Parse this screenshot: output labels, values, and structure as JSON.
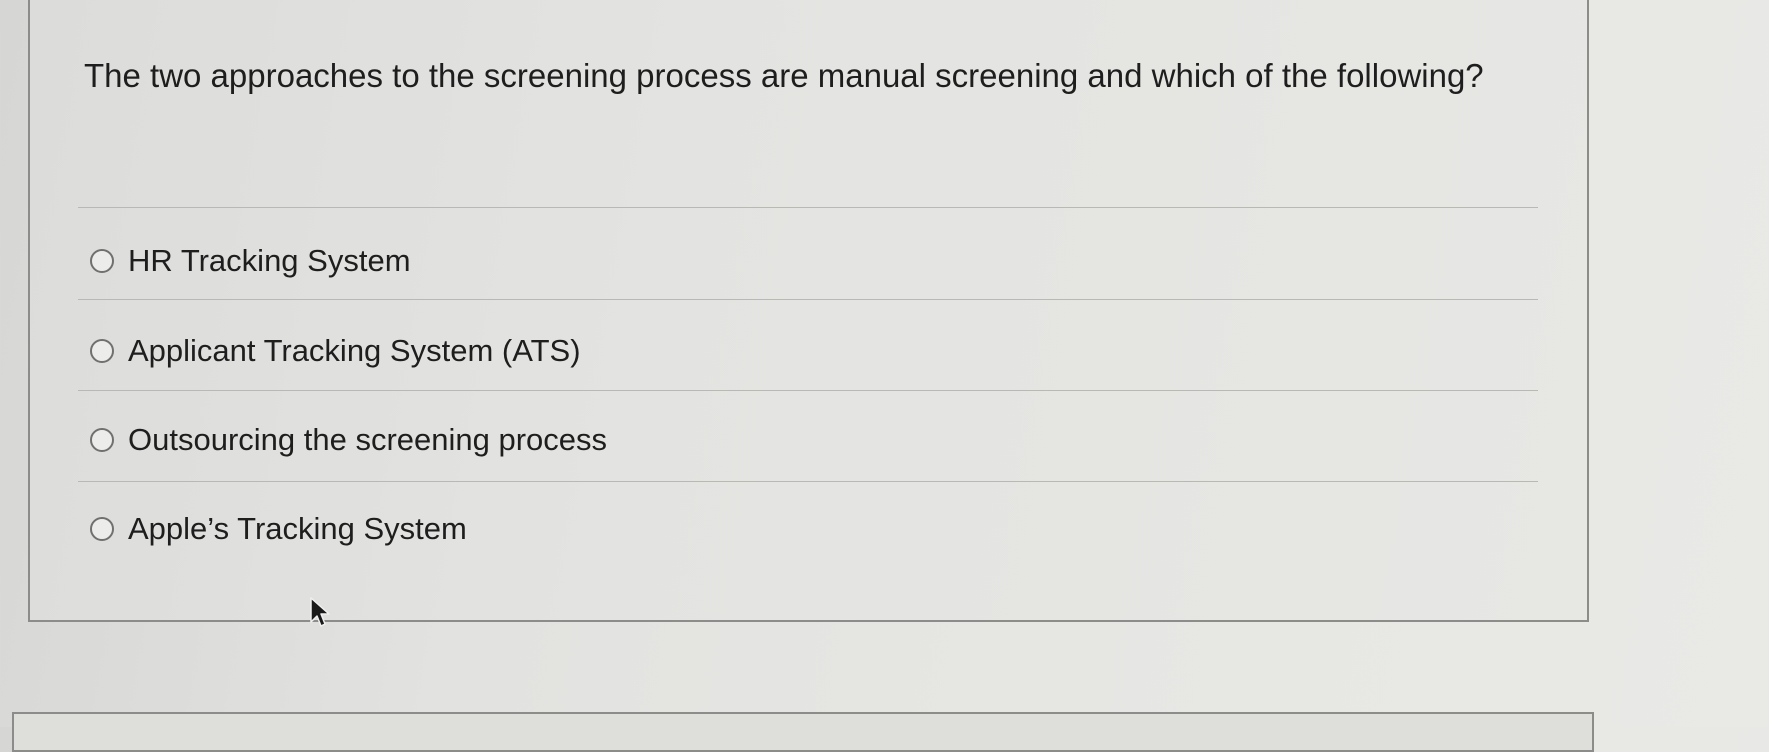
{
  "question": {
    "text": "The two approaches to the screening process are manual screening and which of the following?"
  },
  "options": [
    {
      "label": "HR Tracking System",
      "selected": false
    },
    {
      "label": "Applicant Tracking System (ATS)",
      "selected": false
    },
    {
      "label": "Outsourcing the screening process",
      "selected": false
    },
    {
      "label": "Apple’s Tracking System",
      "selected": false
    }
  ],
  "icons": {
    "radio": "radio-button-unchecked-icon",
    "cursor": "mouse-pointer-icon"
  }
}
